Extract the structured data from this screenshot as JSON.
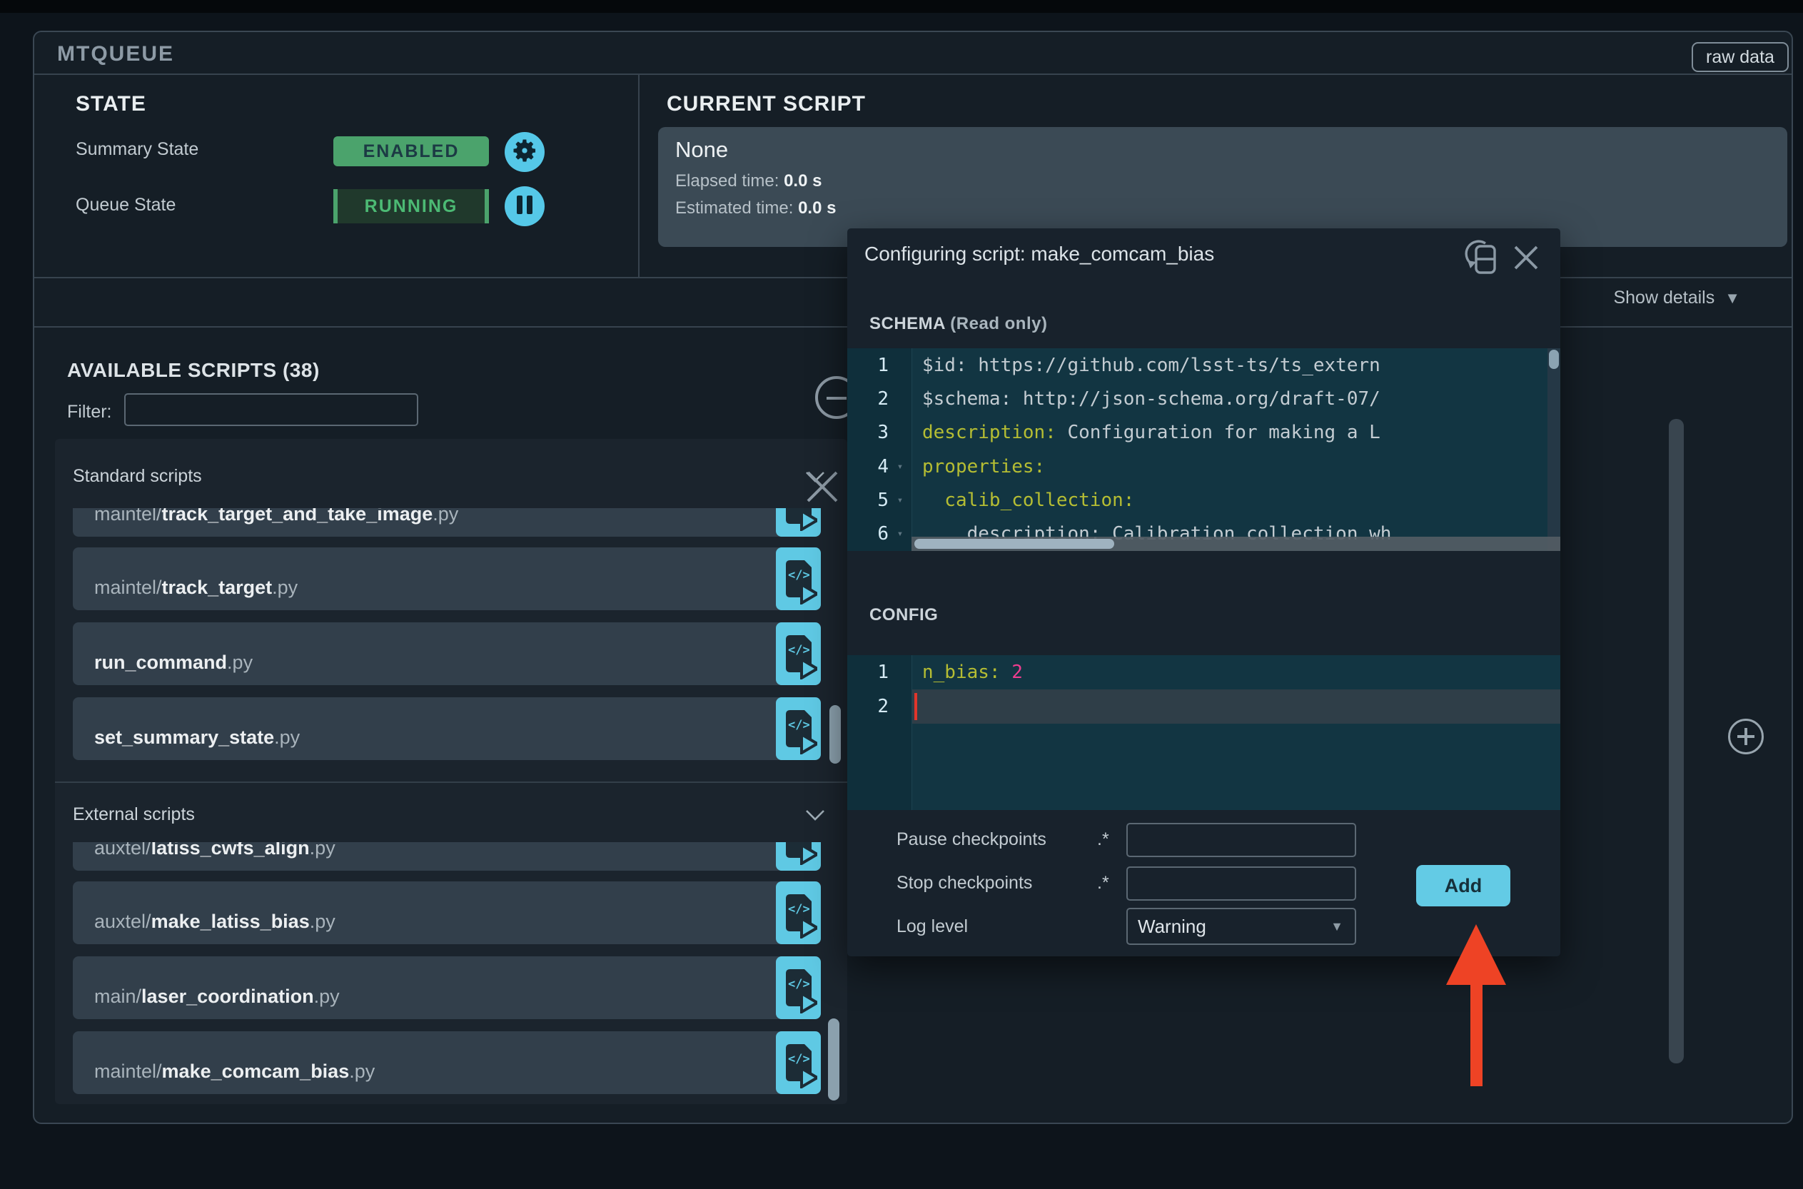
{
  "colors": {
    "accent_cyan": "#5fc9e4",
    "badge_green": "#4ba36c",
    "running_text": "#4cba74",
    "arrow_red": "#ee4325",
    "code_key_yellow": "#b5bd33",
    "code_number_pink": "#ee3d8f",
    "cursor_red": "#e0352b",
    "editor_bg": "#123542"
  },
  "header": {
    "app_title": "MTQUEUE",
    "raw_data_button": "raw data"
  },
  "state": {
    "heading": "STATE",
    "summary_label": "Summary State",
    "summary_value": "ENABLED",
    "queue_label": "Queue State",
    "queue_value": "RUNNING"
  },
  "current_script": {
    "heading": "CURRENT SCRIPT",
    "name": "None",
    "elapsed_label": "Elapsed time:",
    "elapsed_value": "0.0 s",
    "estimated_label": "Estimated time:",
    "estimated_value": "0.0 s"
  },
  "details_toggle": {
    "label": "Show details",
    "arrow": "▼"
  },
  "available_scripts": {
    "heading": "AVAILABLE SCRIPTS (38)",
    "filter_label": "Filter:",
    "filter_value": "",
    "sections": [
      {
        "title": "Standard scripts",
        "scripts": [
          {
            "dir": "maintel/",
            "name": "track_target_and_take_image",
            "ext": ".py",
            "clipped": true
          },
          {
            "dir": "maintel/",
            "name": "track_target",
            "ext": ".py"
          },
          {
            "dir": "",
            "name": "run_command",
            "ext": ".py"
          },
          {
            "dir": "",
            "name": "set_summary_state",
            "ext": ".py"
          }
        ]
      },
      {
        "title": "External scripts",
        "scripts": [
          {
            "dir": "auxtel/",
            "name": "latiss_cwfs_align",
            "ext": ".py",
            "clipped": true
          },
          {
            "dir": "auxtel/",
            "name": "make_latiss_bias",
            "ext": ".py"
          },
          {
            "dir": "main/",
            "name": "laser_coordination",
            "ext": ".py"
          },
          {
            "dir": "maintel/",
            "name": "make_comcam_bias",
            "ext": ".py"
          }
        ]
      }
    ]
  },
  "modal": {
    "title": "Configuring script: make_comcam_bias",
    "schema_heading": "SCHEMA",
    "schema_mode": "(Read only)",
    "schema_lines": [
      {
        "num": "1",
        "fold": false,
        "tokens": [
          {
            "text": "$id: https://github.com/lsst-ts/ts_extern",
            "cls": "plain"
          }
        ]
      },
      {
        "num": "2",
        "fold": false,
        "tokens": [
          {
            "text": "$schema: http://json-schema.org/draft-07/",
            "cls": "plain"
          }
        ]
      },
      {
        "num": "3",
        "fold": false,
        "tokens": [
          {
            "text": "description: ",
            "cls": "key"
          },
          {
            "text": "Configuration for making a L",
            "cls": "plain"
          }
        ]
      },
      {
        "num": "4",
        "fold": true,
        "tokens": [
          {
            "text": "properties:",
            "cls": "key"
          }
        ]
      },
      {
        "num": "5",
        "fold": true,
        "tokens": [
          {
            "text": "  calib_collection:",
            "cls": "key"
          }
        ]
      },
      {
        "num": "6",
        "fold": true,
        "tokens": [
          {
            "text": "    description: Calibration collection wh",
            "cls": "plain"
          }
        ]
      }
    ],
    "config_heading": "CONFIG",
    "config_lines": [
      {
        "num": "1",
        "active": false,
        "cursor": false,
        "tokens": [
          {
            "text": "n_bias: ",
            "cls": "key"
          },
          {
            "text": "2",
            "cls": "num"
          }
        ]
      },
      {
        "num": "2",
        "active": true,
        "cursor": true,
        "tokens": []
      }
    ],
    "form": {
      "pause_label": "Pause checkpoints",
      "pause_pattern": ".*",
      "pause_value": "",
      "stop_label": "Stop checkpoints",
      "stop_pattern": ".*",
      "stop_value": "",
      "log_label": "Log level",
      "log_value": "Warning",
      "log_arrow": "▼",
      "add_button": "Add"
    }
  },
  "icons": {
    "settings": "gear-icon",
    "pause": "pause-icon",
    "launch_script": "code-file-arrow-icon",
    "rotate_view": "rotate-device-icon",
    "close": "x-icon",
    "collapse": "circle-minus-icon",
    "expand_queue": "circle-plus-icon",
    "section_chevron": "chevron-down-icon",
    "fold_marker": "▾"
  }
}
